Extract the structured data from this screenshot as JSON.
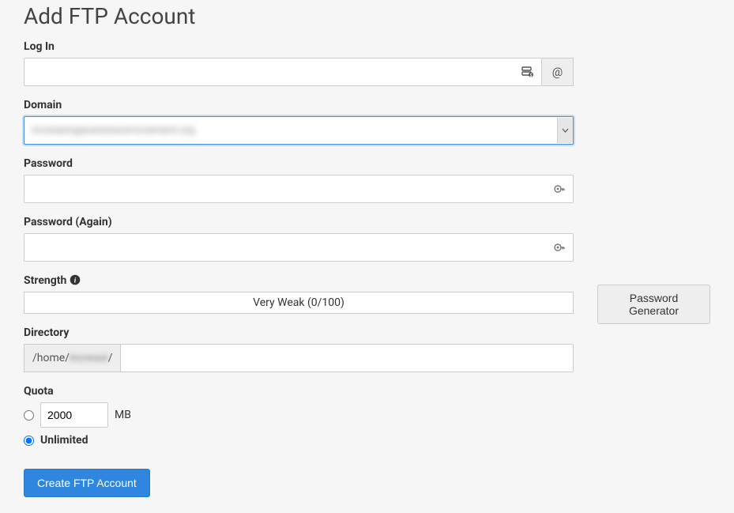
{
  "page_title": "Add FTP Account",
  "login": {
    "label": "Log In",
    "value": "",
    "addon": "@"
  },
  "domain": {
    "label": "Domain",
    "selected_display": "increasingawarenessmovement.org"
  },
  "password": {
    "label": "Password",
    "value": ""
  },
  "password_again": {
    "label": "Password (Again)",
    "value": ""
  },
  "strength": {
    "label": "Strength",
    "text": "Very Weak (0/100)"
  },
  "password_generator_button": "Password Generator",
  "directory": {
    "label": "Directory",
    "prefix_start": "/home/",
    "prefix_blur": "increasi",
    "prefix_end": "/",
    "value": ""
  },
  "quota": {
    "label": "Quota",
    "value": "2000",
    "unit": "MB",
    "unlimited_label": "Unlimited",
    "selected": "unlimited"
  },
  "submit_button": "Create FTP Account"
}
